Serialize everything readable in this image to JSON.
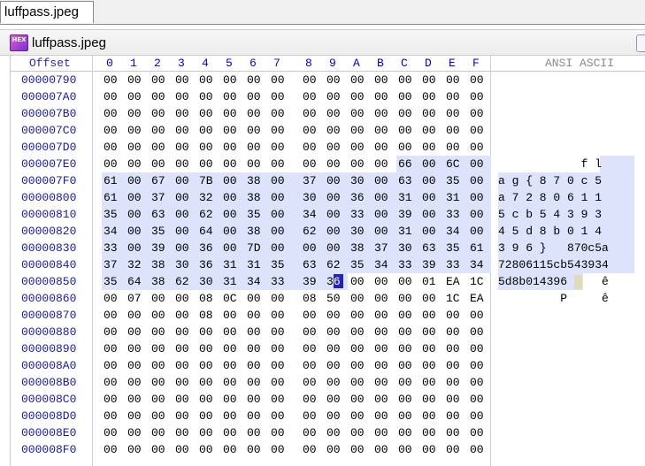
{
  "tab": {
    "label": "luffpass.jpeg"
  },
  "window": {
    "title": "luffpass.jpeg",
    "icon_text": "HEX"
  },
  "header": {
    "offset_label": "Offset",
    "columns": [
      "0",
      "1",
      "2",
      "3",
      "4",
      "5",
      "6",
      "7",
      "8",
      "9",
      "A",
      "B",
      "C",
      "D",
      "E",
      "F"
    ],
    "ansi_label": "ANSI ASCII"
  },
  "colors": {
    "selection": "#dde3fb",
    "caret": "#2323b8",
    "offset_text": "#1a1aa0",
    "header_text": "#0000c8"
  },
  "rows": [
    {
      "offset": "00000790",
      "bytes": [
        "00",
        "00",
        "00",
        "00",
        "00",
        "00",
        "00",
        "00",
        "00",
        "00",
        "00",
        "00",
        "00",
        "00",
        "00",
        "00"
      ],
      "ascii": ""
    },
    {
      "offset": "000007A0",
      "bytes": [
        "00",
        "00",
        "00",
        "00",
        "00",
        "00",
        "00",
        "00",
        "00",
        "00",
        "00",
        "00",
        "00",
        "00",
        "00",
        "00"
      ],
      "ascii": ""
    },
    {
      "offset": "000007B0",
      "bytes": [
        "00",
        "00",
        "00",
        "00",
        "00",
        "00",
        "00",
        "00",
        "00",
        "00",
        "00",
        "00",
        "00",
        "00",
        "00",
        "00"
      ],
      "ascii": ""
    },
    {
      "offset": "000007C0",
      "bytes": [
        "00",
        "00",
        "00",
        "00",
        "00",
        "00",
        "00",
        "00",
        "00",
        "00",
        "00",
        "00",
        "00",
        "00",
        "00",
        "00"
      ],
      "ascii": ""
    },
    {
      "offset": "000007D0",
      "bytes": [
        "00",
        "00",
        "00",
        "00",
        "00",
        "00",
        "00",
        "00",
        "00",
        "00",
        "00",
        "00",
        "00",
        "00",
        "00",
        "00"
      ],
      "ascii": ""
    },
    {
      "offset": "000007E0",
      "bytes": [
        "00",
        "00",
        "00",
        "00",
        "00",
        "00",
        "00",
        "00",
        "00",
        "00",
        "00",
        "00",
        "66",
        "00",
        "6C",
        "00"
      ],
      "ascii": "            f l"
    },
    {
      "offset": "000007F0",
      "bytes": [
        "61",
        "00",
        "67",
        "00",
        "7B",
        "00",
        "38",
        "00",
        "37",
        "00",
        "30",
        "00",
        "63",
        "00",
        "35",
        "00"
      ],
      "ascii": "a g { 8 7 0 c 5"
    },
    {
      "offset": "00000800",
      "bytes": [
        "61",
        "00",
        "37",
        "00",
        "32",
        "00",
        "38",
        "00",
        "30",
        "00",
        "36",
        "00",
        "31",
        "00",
        "31",
        "00"
      ],
      "ascii": "a 7 2 8 0 6 1 1"
    },
    {
      "offset": "00000810",
      "bytes": [
        "35",
        "00",
        "63",
        "00",
        "62",
        "00",
        "35",
        "00",
        "34",
        "00",
        "33",
        "00",
        "39",
        "00",
        "33",
        "00"
      ],
      "ascii": "5 c b 5 4 3 9 3"
    },
    {
      "offset": "00000820",
      "bytes": [
        "34",
        "00",
        "35",
        "00",
        "64",
        "00",
        "38",
        "00",
        "62",
        "00",
        "30",
        "00",
        "31",
        "00",
        "34",
        "00"
      ],
      "ascii": "4 5 d 8 b 0 1 4"
    },
    {
      "offset": "00000830",
      "bytes": [
        "33",
        "00",
        "39",
        "00",
        "36",
        "00",
        "7D",
        "00",
        "00",
        "00",
        "38",
        "37",
        "30",
        "63",
        "35",
        "61"
      ],
      "ascii": "3 9 6 }   870c5a"
    },
    {
      "offset": "00000840",
      "bytes": [
        "37",
        "32",
        "38",
        "30",
        "36",
        "31",
        "31",
        "35",
        "63",
        "62",
        "35",
        "34",
        "33",
        "39",
        "33",
        "34"
      ],
      "ascii": "72806115cb543934"
    },
    {
      "offset": "00000850",
      "bytes": [
        "35",
        "64",
        "38",
        "62",
        "30",
        "31",
        "34",
        "33",
        "39",
        "36",
        "00",
        "00",
        "00",
        "01",
        "EA",
        "1C"
      ],
      "ascii": "5d8b014396     ê"
    },
    {
      "offset": "00000860",
      "bytes": [
        "00",
        "07",
        "00",
        "00",
        "08",
        "0C",
        "00",
        "00",
        "08",
        "50",
        "00",
        "00",
        "00",
        "00",
        "1C",
        "EA"
      ],
      "ascii": "         P     ê"
    },
    {
      "offset": "00000870",
      "bytes": [
        "00",
        "00",
        "00",
        "00",
        "08",
        "00",
        "00",
        "00",
        "00",
        "00",
        "00",
        "00",
        "00",
        "00",
        "00",
        "00"
      ],
      "ascii": ""
    },
    {
      "offset": "00000880",
      "bytes": [
        "00",
        "00",
        "00",
        "00",
        "00",
        "00",
        "00",
        "00",
        "00",
        "00",
        "00",
        "00",
        "00",
        "00",
        "00",
        "00"
      ],
      "ascii": ""
    },
    {
      "offset": "00000890",
      "bytes": [
        "00",
        "00",
        "00",
        "00",
        "00",
        "00",
        "00",
        "00",
        "00",
        "00",
        "00",
        "00",
        "00",
        "00",
        "00",
        "00"
      ],
      "ascii": ""
    },
    {
      "offset": "000008A0",
      "bytes": [
        "00",
        "00",
        "00",
        "00",
        "00",
        "00",
        "00",
        "00",
        "00",
        "00",
        "00",
        "00",
        "00",
        "00",
        "00",
        "00"
      ],
      "ascii": ""
    },
    {
      "offset": "000008B0",
      "bytes": [
        "00",
        "00",
        "00",
        "00",
        "00",
        "00",
        "00",
        "00",
        "00",
        "00",
        "00",
        "00",
        "00",
        "00",
        "00",
        "00"
      ],
      "ascii": ""
    },
    {
      "offset": "000008C0",
      "bytes": [
        "00",
        "00",
        "00",
        "00",
        "00",
        "00",
        "00",
        "00",
        "00",
        "00",
        "00",
        "00",
        "00",
        "00",
        "00",
        "00"
      ],
      "ascii": ""
    },
    {
      "offset": "000008D0",
      "bytes": [
        "00",
        "00",
        "00",
        "00",
        "00",
        "00",
        "00",
        "00",
        "00",
        "00",
        "00",
        "00",
        "00",
        "00",
        "00",
        "00"
      ],
      "ascii": ""
    },
    {
      "offset": "000008E0",
      "bytes": [
        "00",
        "00",
        "00",
        "00",
        "00",
        "00",
        "00",
        "00",
        "00",
        "00",
        "00",
        "00",
        "00",
        "00",
        "00",
        "00"
      ],
      "ascii": ""
    },
    {
      "offset": "000008F0",
      "bytes": [
        "00",
        "00",
        "00",
        "00",
        "00",
        "00",
        "00",
        "00",
        "00",
        "00",
        "00",
        "00",
        "00",
        "00",
        "00",
        "00"
      ],
      "ascii": ""
    }
  ],
  "selection": {
    "start": "000007EC",
    "end": "00000859",
    "caret": "00000859"
  }
}
